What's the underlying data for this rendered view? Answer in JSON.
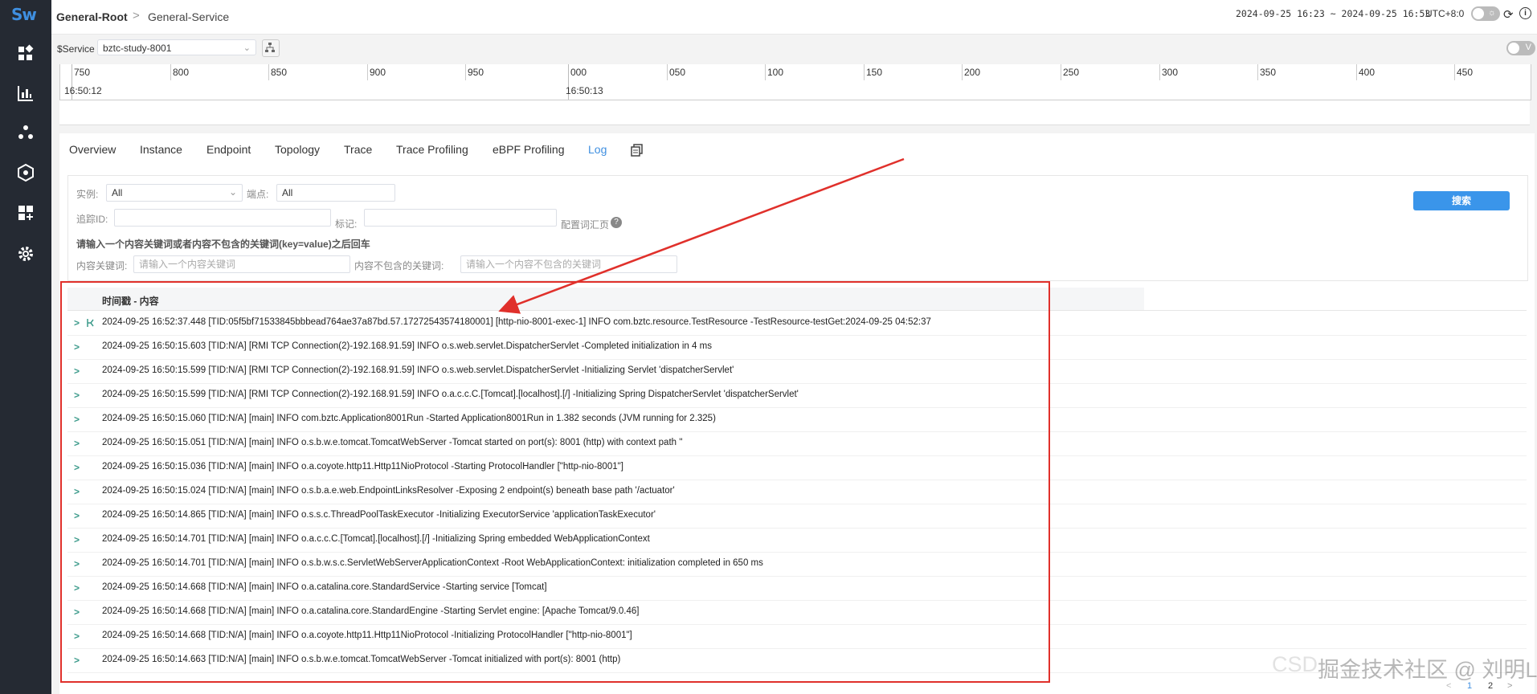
{
  "sidebar": {
    "logo": "Sw",
    "items": [
      {
        "icon": "dashboard-icon"
      },
      {
        "icon": "chart-icon"
      },
      {
        "icon": "topology-icon"
      },
      {
        "icon": "shield-icon"
      },
      {
        "icon": "add-widget-icon"
      },
      {
        "icon": "gear-icon"
      }
    ]
  },
  "header": {
    "breadcrumb_root": "General-Root",
    "breadcrumb_sep": ">",
    "breadcrumb_current": "General-Service",
    "time_range": "2024-09-25 16:23 ~ 2024-09-25 16:53",
    "timezone": "UTC+8:0",
    "v_toggle_label": "V"
  },
  "service_bar": {
    "label": "$Service",
    "selected": "bztc-study-8001"
  },
  "timeline": {
    "ticks": [
      "750",
      "800",
      "850",
      "900",
      "950",
      "000",
      "050",
      "100",
      "150",
      "200",
      "250",
      "300",
      "350",
      "400",
      "450"
    ],
    "time_labels": [
      "16:50:12",
      "16:50:13"
    ]
  },
  "tabs": [
    {
      "label": "Overview",
      "active": false
    },
    {
      "label": "Instance",
      "active": false
    },
    {
      "label": "Endpoint",
      "active": false
    },
    {
      "label": "Topology",
      "active": false
    },
    {
      "label": "Trace",
      "active": false
    },
    {
      "label": "Trace Profiling",
      "active": false
    },
    {
      "label": "eBPF Profiling",
      "active": false
    },
    {
      "label": "Log",
      "active": true
    }
  ],
  "filters": {
    "instance_label": "实例:",
    "instance_value": "All",
    "endpoint_label": "端点:",
    "endpoint_value": "All",
    "trace_id_label": "追踪ID:",
    "tags_label": "标记:",
    "config_label": "配置词汇页",
    "hint": "请输入一个内容关键词或者内容不包含的关键词(key=value)之后回车",
    "keyword_label": "内容关键词:",
    "keyword_placeholder": "请输入一个内容关键词",
    "exclude_label": "内容不包含的关键词:",
    "exclude_placeholder": "请输入一个内容不包含的关键词",
    "search_button": "搜索"
  },
  "log_table": {
    "header": "时间戳 - 内容",
    "rows": [
      "2024-09-25 16:52:37.448 [TID:05f5bf71533845bbbead764ae37a87bd.57.17272543574180001] [http-nio-8001-exec-1] INFO com.bztc.resource.TestResource -TestResource-testGet:2024-09-25 04:52:37",
      "2024-09-25 16:50:15.603 [TID:N/A] [RMI TCP Connection(2)-192.168.91.59] INFO o.s.web.servlet.DispatcherServlet -Completed initialization in 4 ms",
      "2024-09-25 16:50:15.599 [TID:N/A] [RMI TCP Connection(2)-192.168.91.59] INFO o.s.web.servlet.DispatcherServlet -Initializing Servlet 'dispatcherServlet'",
      "2024-09-25 16:50:15.599 [TID:N/A] [RMI TCP Connection(2)-192.168.91.59] INFO o.a.c.c.C.[Tomcat].[localhost].[/] -Initializing Spring DispatcherServlet 'dispatcherServlet'",
      "2024-09-25 16:50:15.060 [TID:N/A] [main] INFO com.bztc.Application8001Run -Started Application8001Run in 1.382 seconds (JVM running for 2.325)",
      "2024-09-25 16:50:15.051 [TID:N/A] [main] INFO o.s.b.w.e.tomcat.TomcatWebServer -Tomcat started on port(s): 8001 (http) with context path ''",
      "2024-09-25 16:50:15.036 [TID:N/A] [main] INFO o.a.coyote.http11.Http11NioProtocol -Starting ProtocolHandler [\"http-nio-8001\"]",
      "2024-09-25 16:50:15.024 [TID:N/A] [main] INFO o.s.b.a.e.web.EndpointLinksResolver -Exposing 2 endpoint(s) beneath base path '/actuator'",
      "2024-09-25 16:50:14.865 [TID:N/A] [main] INFO o.s.s.c.ThreadPoolTaskExecutor -Initializing ExecutorService 'applicationTaskExecutor'",
      "2024-09-25 16:50:14.701 [TID:N/A] [main] INFO o.a.c.c.C.[Tomcat].[localhost].[/] -Initializing Spring embedded WebApplicationContext",
      "2024-09-25 16:50:14.701 [TID:N/A] [main] INFO o.s.b.w.s.c.ServletWebServerApplicationContext -Root WebApplicationContext: initialization completed in 650 ms",
      "2024-09-25 16:50:14.668 [TID:N/A] [main] INFO o.a.catalina.core.StandardService -Starting service [Tomcat]",
      "2024-09-25 16:50:14.668 [TID:N/A] [main] INFO o.a.catalina.core.StandardEngine -Starting Servlet engine: [Apache Tomcat/9.0.46]",
      "2024-09-25 16:50:14.668 [TID:N/A] [main] INFO o.a.coyote.http11.Http11NioProtocol -Initializing ProtocolHandler [\"http-nio-8001\"]",
      "2024-09-25 16:50:14.663 [TID:N/A] [main] INFO o.s.b.w.e.tomcat.TomcatWebServer -Tomcat initialized with port(s): 8001 (http)"
    ]
  },
  "pagination": {
    "page1": "1",
    "page2": "2",
    "prev": "<",
    "next": ">"
  },
  "watermark": {
    "lead": "CSD",
    "text": "掘金技术社区 @ 刘明L"
  },
  "colors": {
    "accent": "#3f8fe0",
    "sidebar_bg": "#252a33",
    "highlight": "#e0302b",
    "chevron": "#3b9a8a"
  }
}
